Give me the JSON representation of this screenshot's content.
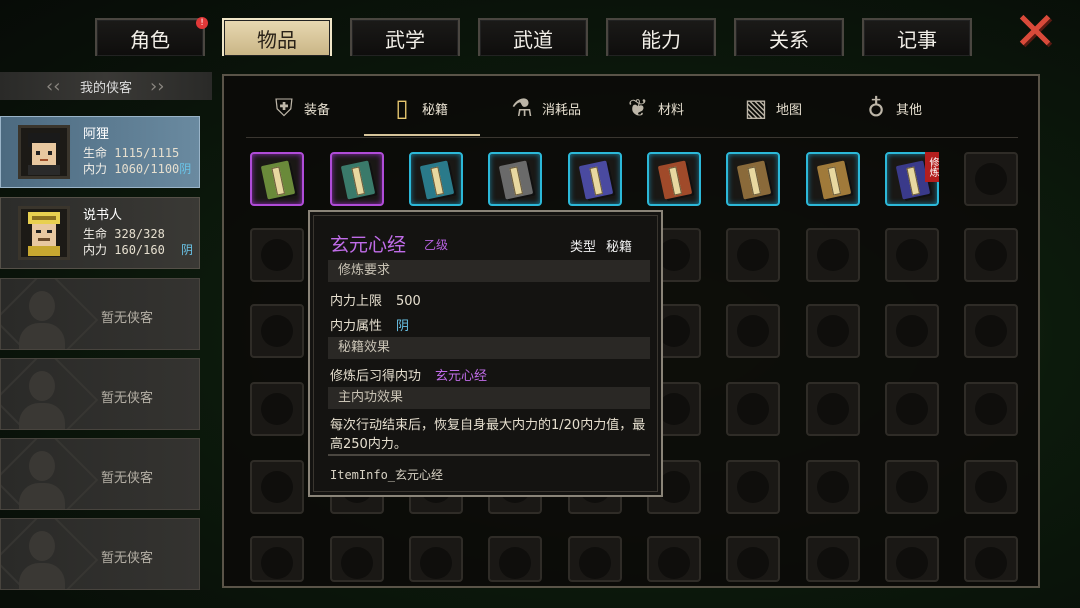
{
  "top_tabs": [
    {
      "label": "角色",
      "badge": "!"
    },
    {
      "label": "物品"
    },
    {
      "label": "武学"
    },
    {
      "label": "武道"
    },
    {
      "label": "能力"
    },
    {
      "label": "关系"
    },
    {
      "label": "记事"
    }
  ],
  "active_top_tab": "物品",
  "close_icon": "close-icon",
  "roster": {
    "header": "我的侠客",
    "members": [
      {
        "name": "阿狸",
        "hp_label": "生命",
        "hp": "1115/1115",
        "mp_label": "内力",
        "mp": "1060/1100",
        "attr": "阴"
      },
      {
        "name": "说书人",
        "hp_label": "生命",
        "hp": "328/328",
        "mp_label": "内力",
        "mp": "160/160",
        "attr": "阴"
      }
    ],
    "empty_label": "暂无侠客"
  },
  "sub_tabs": [
    {
      "label": "装备",
      "icon": "armor-icon"
    },
    {
      "label": "秘籍",
      "icon": "scroll-book-icon"
    },
    {
      "label": "消耗品",
      "icon": "potion-icon"
    },
    {
      "label": "材料",
      "icon": "herb-icon"
    },
    {
      "label": "地图",
      "icon": "map-icon"
    },
    {
      "label": "其他",
      "icon": "pendant-icon"
    }
  ],
  "active_sub_tab": "秘籍",
  "items": [
    {
      "rarity": "purple",
      "cover": "#6a8a3a"
    },
    {
      "rarity": "purple",
      "cover": "#3a7a6a"
    },
    {
      "rarity": "cyan",
      "cover": "#2a7a8a"
    },
    {
      "rarity": "cyan",
      "cover": "#6a6a6a"
    },
    {
      "rarity": "cyan",
      "cover": "#4a4aa0"
    },
    {
      "rarity": "cyan",
      "cover": "#a04a2a"
    },
    {
      "rarity": "cyan",
      "cover": "#8a6a3a"
    },
    {
      "rarity": "cyan",
      "cover": "#a07a3a"
    },
    {
      "rarity": "cyan",
      "cover": "#3a3a8a",
      "tag": "修炼"
    }
  ],
  "tooltip": {
    "name": "玄元心经",
    "grade": "乙级",
    "type_label": "类型",
    "type_value": "秘籍",
    "req_header": "修炼要求",
    "req_mp_label": "内力上限",
    "req_mp_value": "500",
    "req_attr_label": "内力属性",
    "req_attr_value": "阴",
    "effect_header": "秘籍效果",
    "effect_label": "修炼后习得内功",
    "effect_value": "玄元心经",
    "main_header": "主内功效果",
    "main_desc": "每次行动结束后，恢复自身最大内力的1/20内力值，最高250内力。",
    "footer": "ItemInfo_玄元心经"
  }
}
